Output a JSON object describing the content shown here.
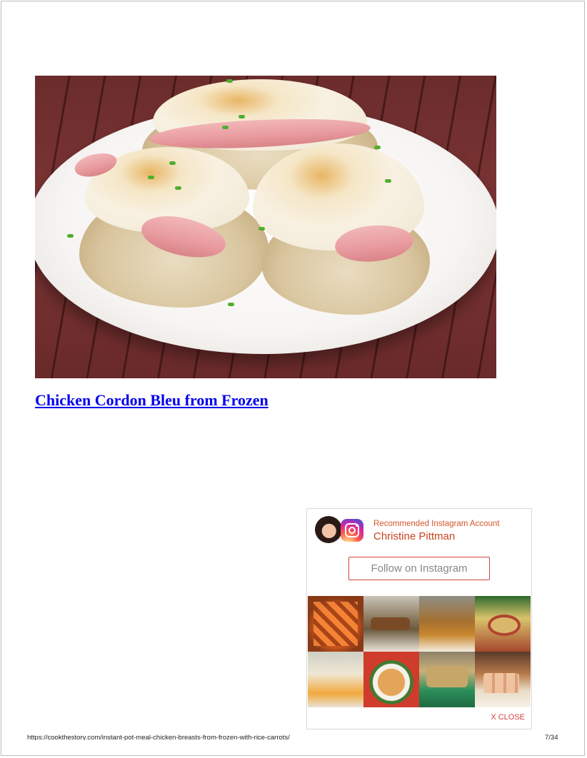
{
  "recipe": {
    "title": "Chicken Cordon Bleu from Frozen"
  },
  "instagram_widget": {
    "recommended_label": "Recommended Instagram Account",
    "account_name": "Christine Pittman",
    "follow_button": "Follow on Instagram",
    "close_label": "X CLOSE",
    "brand_color": "#d0433d",
    "thumbnails": [
      {
        "icon": "sweet-potato-cubes"
      },
      {
        "icon": "grilled-ribs"
      },
      {
        "icon": "roast-chicken"
      },
      {
        "icon": "baked-dip"
      },
      {
        "icon": "cheese-sauce"
      },
      {
        "icon": "pasta-bowl"
      },
      {
        "icon": "casserole-dish"
      },
      {
        "icon": "layered-bars"
      }
    ]
  },
  "footer": {
    "url": "https://cookthestory.com/instant-pot-meal-chicken-breasts-from-frozen-with-rice-carrots/",
    "page": "7/34"
  }
}
